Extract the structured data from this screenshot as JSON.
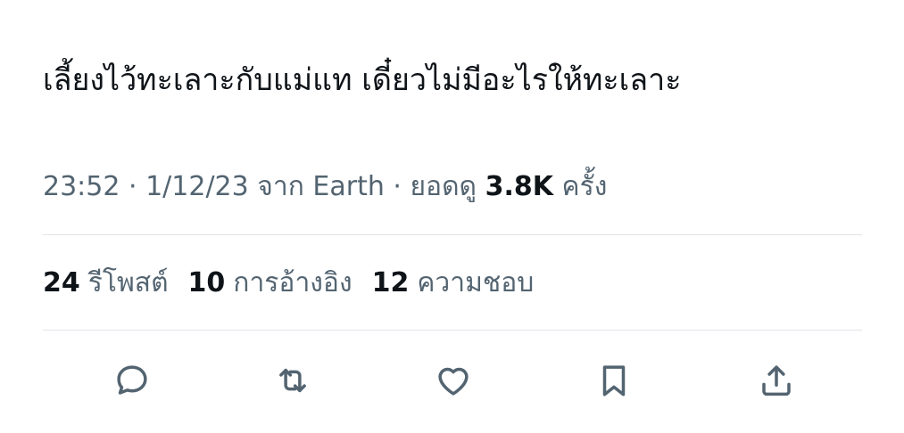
{
  "tweet": {
    "text": "เลี้ยงไว้ทะเลาะกับแม่แท เดี๋ยวไม่มีอะไรให้ทะเลาะ",
    "meta": {
      "time": "23:52",
      "separator1": " · ",
      "date": "1/12/23",
      "source_prefix": " จาก ",
      "source": "Earth",
      "separator2": " · ",
      "views_label": "ยอดดู ",
      "views_count": "3.8K",
      "views_suffix": " ครั้ง"
    },
    "stats": [
      {
        "count": "24",
        "label": "รีโพสต์"
      },
      {
        "count": "10",
        "label": "การอ้างอิง"
      },
      {
        "count": "12",
        "label": "ความชอบ"
      }
    ],
    "actions": {
      "reply_icon": "reply-icon",
      "retweet_icon": "retweet-icon",
      "like_icon": "heart-icon",
      "bookmark_icon": "bookmark-icon",
      "share_icon": "share-icon"
    }
  },
  "colors": {
    "text_primary": "#0f1419",
    "text_secondary": "#536471",
    "divider": "#e1e4e8",
    "background": "#ffffff"
  }
}
